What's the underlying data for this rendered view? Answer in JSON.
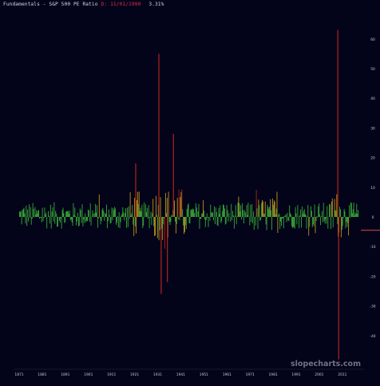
{
  "header": {
    "title": "Fundamentals - S&P 500 PE Ratio",
    "date_label": "D: 11/01/1990",
    "last_value": "3.31%"
  },
  "watermark": "slopecharts.com",
  "colors": {
    "background": "#03041a",
    "positive": "#3fb83a",
    "warm": "#d3a21c",
    "extreme": "#c1271b",
    "last_value_line": "#e05040",
    "text": "#d7d7e2",
    "date_text": "#e0304a",
    "axis_text": "#c8c8d2"
  },
  "chart_data": {
    "type": "bar",
    "title": "Fundamentals - S&P 500 PE Ratio",
    "xlabel": "",
    "ylabel": "",
    "xlim": [
      1871,
      2019
    ],
    "ylim": [
      -50,
      60
    ],
    "grid": false,
    "last_value": -4.5,
    "x_ticks": [
      1871,
      1881,
      1891,
      1901,
      1911,
      1921,
      1931,
      1941,
      1951,
      1961,
      1971,
      1981,
      1991,
      2001,
      2011
    ],
    "y_ticks": [
      60,
      50,
      40,
      30,
      20,
      10,
      0,
      -10,
      -20,
      -30,
      -40
    ],
    "notable_values": [
      {
        "x": 1921.5,
        "y": 18
      },
      {
        "x": 1931.5,
        "y": 55
      },
      {
        "x": 1932.5,
        "y": -26
      },
      {
        "x": 1937.8,
        "y": 28
      },
      {
        "x": 1935.2,
        "y": -22
      },
      {
        "x": 2009.0,
        "y": 63
      },
      {
        "x": 2009.4,
        "y": -48
      }
    ]
  }
}
